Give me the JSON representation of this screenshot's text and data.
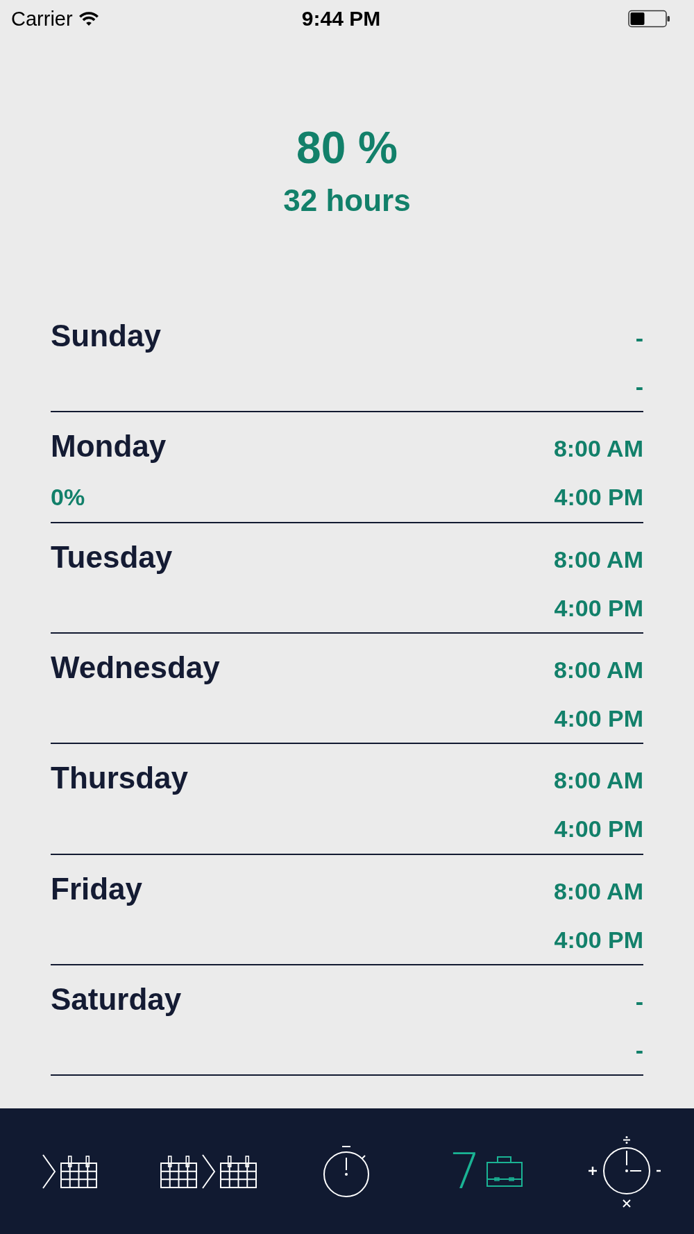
{
  "status_bar": {
    "carrier": "Carrier",
    "time": "9:44 PM"
  },
  "summary": {
    "percent": "80 %",
    "hours": "32 hours"
  },
  "days": [
    {
      "name": "Sunday",
      "start": "-",
      "end": "-"
    },
    {
      "name": "Monday",
      "start": "8:00 AM",
      "end": "4:00 PM",
      "progress": "0%"
    },
    {
      "name": "Tuesday",
      "start": "8:00 AM",
      "end": "4:00 PM"
    },
    {
      "name": "Wednesday",
      "start": "8:00 AM",
      "end": "4:00 PM"
    },
    {
      "name": "Thursday",
      "start": "8:00 AM",
      "end": "4:00 PM"
    },
    {
      "name": "Friday",
      "start": "8:00 AM",
      "end": "4:00 PM"
    },
    {
      "name": "Saturday",
      "start": "-",
      "end": "-"
    }
  ],
  "tab_bar": {
    "tabs": [
      {
        "kind": "next-calendar",
        "selected": false
      },
      {
        "kind": "calendar-transfer",
        "selected": false
      },
      {
        "kind": "stopwatch",
        "selected": false
      },
      {
        "kind": "work-week",
        "label": "7",
        "selected": true
      },
      {
        "kind": "clock-math",
        "selected": false
      }
    ]
  }
}
